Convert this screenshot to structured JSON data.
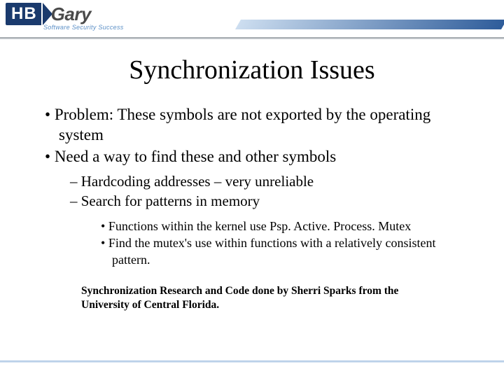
{
  "logo": {
    "left": "HB",
    "right": "Gary",
    "tagline": "Software Security Success"
  },
  "title": "Synchronization Issues",
  "bullets": {
    "l1a": "Problem: These symbols are not exported  by the operating system",
    "l1b": "Need a way to find these and other symbols",
    "l2a": "Hardcoding addresses – very unreliable",
    "l2b": "Search for patterns in memory",
    "l3a": "Functions within the kernel use Psp. Active. Process. Mutex",
    "l3b": "Find the mutex's use within functions with a relatively consistent pattern."
  },
  "credit": "Synchronization Research and Code done by Sherri Sparks from the University of Central Florida."
}
